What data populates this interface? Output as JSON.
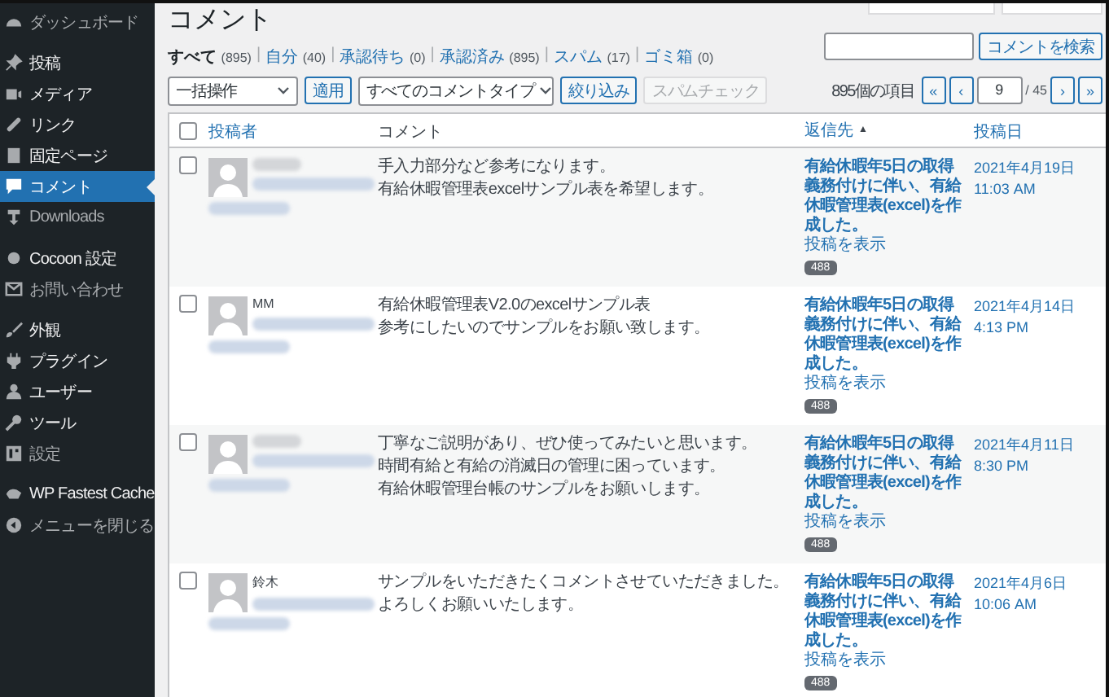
{
  "sidebar": {
    "groups": [
      {
        "items": [
          {
            "label": "ダッシュボード",
            "selected": false
          }
        ]
      },
      {
        "items": [
          {
            "label": "投稿",
            "selected": false
          },
          {
            "label": "メディア",
            "selected": false
          },
          {
            "label": "リンク",
            "selected": false
          },
          {
            "label": "固定ページ",
            "selected": false
          },
          {
            "label": "コメント",
            "selected": true
          },
          {
            "label": "Downloads",
            "selected": false
          }
        ]
      },
      {
        "items": [
          {
            "label": "Cocoon 設定",
            "selected": false
          },
          {
            "label": "お問い合わせ",
            "selected": false
          }
        ]
      },
      {
        "items": [
          {
            "label": "外観",
            "selected": false
          },
          {
            "label": "プラグイン",
            "selected": false
          },
          {
            "label": "ユーザー",
            "selected": false
          },
          {
            "label": "ツール",
            "selected": false
          },
          {
            "label": "設定",
            "selected": false
          }
        ]
      },
      {
        "items": [
          {
            "label": "WP Fastest Cache",
            "selected": false
          },
          {
            "label": "メニューを閉じる",
            "selected": false
          }
        ]
      }
    ]
  },
  "page_title": "コメント",
  "filter_separator": "|",
  "filters": [
    {
      "label": "すべて",
      "count": "(895)",
      "selected": true
    },
    {
      "label": "自分",
      "count": "(40)",
      "selected": false
    },
    {
      "label": "承認待ち",
      "count": "(0)",
      "selected": false
    },
    {
      "label": "承認済み",
      "count": "(895)",
      "selected": false
    },
    {
      "label": "スパム",
      "count": "(17)",
      "selected": false
    },
    {
      "label": "ゴミ箱",
      "count": "(0)",
      "selected": false
    }
  ],
  "search": {
    "button": "コメントを検索"
  },
  "bulk_action": {
    "value": "一括操作",
    "apply": "適用"
  },
  "type_filter": {
    "value": "すべてのコメントタイプ",
    "apply": "絞り込み"
  },
  "spam_check": {
    "label": "スパムチェック",
    "disabled": true
  },
  "pagination": {
    "items_count": "895個の項目",
    "first": "«",
    "prev": "‹",
    "page": "9",
    "total": "/ 45",
    "next": "›",
    "last": "»"
  },
  "table": {
    "header_checked": false,
    "columns": {
      "author": "投稿者",
      "comment": "コメント",
      "response": "返信先",
      "sort_indicator": "▲",
      "date": "投稿日"
    },
    "rows": [
      {
        "checked": false,
        "author": "",
        "comment": [
          "手入力部分など参考になります。",
          "有給休暇管理表excelサンプル表を希望します。"
        ],
        "response": "有給休暇年5日の取得義務付けに伴い、有給休暇管理表(excel)を作成した。",
        "view_post": "投稿を表示",
        "count": "488",
        "date": "2021年4月19日 11:03 AM"
      },
      {
        "checked": false,
        "author": "MM",
        "comment": [
          "有給休暇管理表V2.0のexcelサンプル表",
          "参考にしたいのでサンプルをお願い致します。"
        ],
        "response": "有給休暇年5日の取得義務付けに伴い、有給休暇管理表(excel)を作成した。",
        "view_post": "投稿を表示",
        "count": "488",
        "date": "2021年4月14日 4:13 PM"
      },
      {
        "checked": false,
        "author": "",
        "comment": [
          "丁寧なご説明があり、ぜひ使ってみたいと思います。",
          "時間有給と有給の消滅日の管理に困っています。",
          "有給休暇管理台帳のサンプルをお願いします。"
        ],
        "response": "有給休暇年5日の取得義務付けに伴い、有給休暇管理表(excel)を作成した。",
        "view_post": "投稿を表示",
        "count": "488",
        "date": "2021年4月11日 8:30 PM"
      },
      {
        "checked": false,
        "author": "鈴木",
        "comment": [
          "サンプルをいただきたくコメントさせていただきました。",
          "よろしくお願いいたします。"
        ],
        "response": "有給休暇年5日の取得義務付けに伴い、有給休暇管理表(excel)を作成した。",
        "view_post": "投稿を表示",
        "count": "488",
        "date": "2021年4月6日 10:06 AM"
      }
    ]
  }
}
